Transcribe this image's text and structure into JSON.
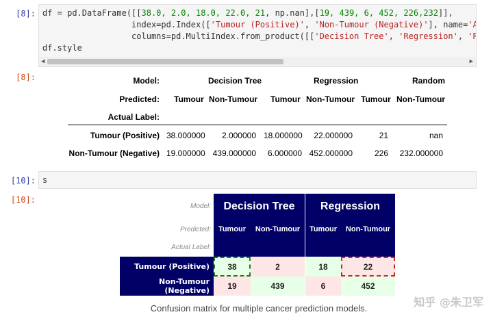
{
  "cell8": {
    "in_prompt": "[8]:",
    "out_prompt": "[8]:",
    "code": {
      "line1_a": "df = pd.DataFrame([[",
      "line1_nums": "38.0, 2.0, 18.0, 22.0, 21",
      "line1_b": ", np.nan],[",
      "line1_nums2": "19, 439, 6, 452, 226,232",
      "line1_c": "]],",
      "line2_a": "                  index=pd.Index([",
      "line2_s1": "'Tumour (Positive)'",
      "line2_b": ", ",
      "line2_s2": "'Non-Tumour (Negative)'",
      "line2_c": "], name=",
      "line2_s3": "'A",
      "line3_a": "                  columns=pd.MultiIndex.from_product([[",
      "line3_s1": "'Decision Tree'",
      "line3_b": ", ",
      "line3_s2": "'Regression'",
      "line3_c": ", ",
      "line3_s3": "'R",
      "line4": "df.style"
    },
    "table": {
      "col_level0_label": "Model:",
      "col_level1_label": "Predicted:",
      "index_name": "Actual Label:",
      "models": [
        "Decision Tree",
        "Regression",
        "Random"
      ],
      "predicted": [
        "Tumour",
        "Non-Tumour",
        "Tumour",
        "Non-Tumour",
        "Tumour",
        "Non-Tumour"
      ],
      "rows": [
        {
          "label": "Tumour (Positive)",
          "values": [
            "38.000000",
            "2.000000",
            "18.000000",
            "22.000000",
            "21",
            "nan"
          ]
        },
        {
          "label": "Non-Tumour (Negative)",
          "values": [
            "19.000000",
            "439.000000",
            "6.000000",
            "452.000000",
            "226",
            "232.000000"
          ]
        }
      ]
    }
  },
  "cell10": {
    "in_prompt": "[10]:",
    "out_prompt": "[10]:",
    "code": "s",
    "table": {
      "col_level0_label": "Model:",
      "col_level1_label": "Predicted:",
      "index_name": "Actual Label:",
      "models": [
        "Decision Tree",
        "Regression"
      ],
      "predicted": [
        "Tumour",
        "Non-Tumour",
        "Tumour",
        "Non-Tumour"
      ],
      "rows": [
        {
          "label": "Tumour (Positive)",
          "values": [
            "38",
            "2",
            "18",
            "22"
          ]
        },
        {
          "label": "Non-Tumour (Negative)",
          "values": [
            "19",
            "439",
            "6",
            "452"
          ]
        }
      ]
    },
    "caption": "Confusion matrix for multiple cancer prediction models."
  },
  "watermark": "知乎 @朱卫军",
  "colors": {
    "header_navy": "#000066",
    "correct_green": "#e6ffe6",
    "wrong_red": "#ffe6e6",
    "border_green": "#1b7a1b",
    "border_red": "#c62828"
  }
}
